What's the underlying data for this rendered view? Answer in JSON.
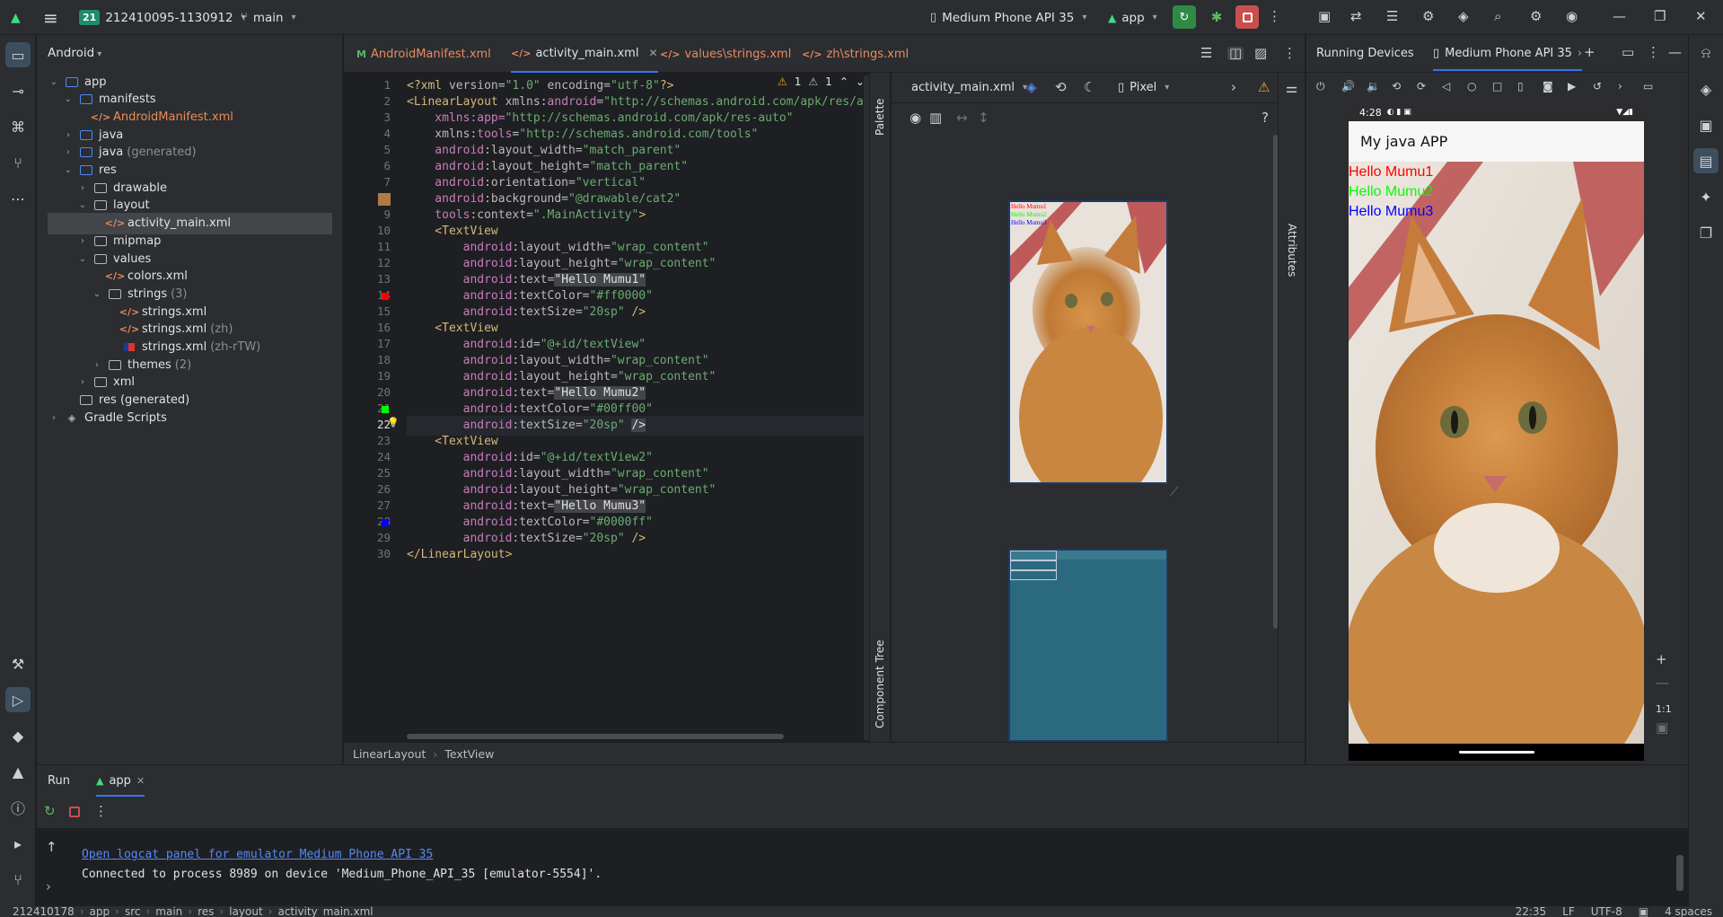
{
  "titlebar": {
    "project_badge": "21",
    "project_name": "212410095-1130912",
    "branch": "main",
    "device": "Medium Phone API 35",
    "run_config": "app"
  },
  "sidebar_left": {
    "items": [
      "folder-icon",
      "commit-icon",
      "structure-icon",
      "vcs-icon",
      "more-icon",
      "build-icon",
      "running-devices-icon",
      "gem-icon",
      "terminal-icon",
      "problems-icon",
      "console-icon",
      "git-icon"
    ]
  },
  "project": {
    "view": "Android",
    "tree": [
      {
        "label": "app",
        "indent": 0,
        "arrow": "open",
        "icon": "folder-blue",
        "sub": ""
      },
      {
        "label": "manifests",
        "indent": 1,
        "arrow": "open",
        "icon": "folder-blue",
        "sub": ""
      },
      {
        "label": "AndroidManifest.xml",
        "indent": 2,
        "arrow": "",
        "icon": "xml",
        "sub": "",
        "orange": true
      },
      {
        "label": "java",
        "indent": 1,
        "arrow": "closed",
        "icon": "folder-blue",
        "sub": ""
      },
      {
        "label": "java",
        "indent": 1,
        "arrow": "closed",
        "icon": "folder-blue",
        "sub": "(generated)"
      },
      {
        "label": "res",
        "indent": 1,
        "arrow": "open",
        "icon": "folder-blue",
        "sub": ""
      },
      {
        "label": "drawable",
        "indent": 2,
        "arrow": "closed",
        "icon": "folder",
        "sub": ""
      },
      {
        "label": "layout",
        "indent": 2,
        "arrow": "open",
        "icon": "folder",
        "sub": ""
      },
      {
        "label": "activity_main.xml",
        "indent": 3,
        "arrow": "",
        "icon": "xml",
        "sub": "",
        "selected": true
      },
      {
        "label": "mipmap",
        "indent": 2,
        "arrow": "closed",
        "icon": "folder",
        "sub": ""
      },
      {
        "label": "values",
        "indent": 2,
        "arrow": "open",
        "icon": "folder",
        "sub": ""
      },
      {
        "label": "colors.xml",
        "indent": 3,
        "arrow": "",
        "icon": "xml",
        "sub": ""
      },
      {
        "label": "strings",
        "indent": 3,
        "arrow": "open",
        "icon": "folder",
        "sub": "(3)"
      },
      {
        "label": "strings.xml",
        "indent": 4,
        "arrow": "",
        "icon": "xml",
        "sub": ""
      },
      {
        "label": "strings.xml",
        "indent": 4,
        "arrow": "",
        "icon": "xml",
        "sub": "(zh)"
      },
      {
        "label": "strings.xml",
        "indent": 4,
        "arrow": "",
        "icon": "flag",
        "sub": "(zh-rTW)"
      },
      {
        "label": "themes",
        "indent": 3,
        "arrow": "closed",
        "icon": "folder",
        "sub": "(2)"
      },
      {
        "label": "xml",
        "indent": 2,
        "arrow": "closed",
        "icon": "folder",
        "sub": ""
      },
      {
        "label": "res (generated)",
        "indent": 1,
        "arrow": "",
        "icon": "folder",
        "sub": ""
      },
      {
        "label": "Gradle Scripts",
        "indent": 0,
        "arrow": "closed",
        "icon": "gradle",
        "sub": ""
      }
    ]
  },
  "editor_tabs": [
    {
      "label": "AndroidManifest.xml",
      "active": false,
      "icon": "m"
    },
    {
      "label": "activity_main.xml",
      "active": true,
      "icon": "xml"
    },
    {
      "label": "values\\strings.xml",
      "active": false,
      "icon": "xml"
    },
    {
      "label": "zh\\strings.xml",
      "active": false,
      "icon": "xml"
    }
  ],
  "code_info": {
    "warnings": "1",
    "weak": "1"
  },
  "current_line": 22,
  "code_lines": [
    [
      [
        "tg",
        "<?xml "
      ],
      [
        "at",
        "version="
      ],
      [
        "st",
        "\"1.0\""
      ],
      [
        "at",
        " encoding="
      ],
      [
        "st",
        "\"utf-8\""
      ],
      [
        "tg",
        "?>"
      ]
    ],
    [
      [
        "tg",
        "<LinearLayout "
      ],
      [
        "at",
        "xmlns:"
      ],
      [
        "ns",
        "android"
      ],
      [
        "at",
        "="
      ],
      [
        "st",
        "\"http://schemas.android.com/apk/res/a"
      ]
    ],
    [
      [
        "ns",
        "    xmlns:app="
      ],
      [
        "st",
        "\"http://schemas.android.com/apk/res-auto\""
      ]
    ],
    [
      [
        "at",
        "    xmlns:"
      ],
      [
        "ns",
        "tools"
      ],
      [
        "at",
        "="
      ],
      [
        "st",
        "\"http://schemas.android.com/tools\""
      ]
    ],
    [
      [
        "ns",
        "    android"
      ],
      [
        "at",
        ":layout_width="
      ],
      [
        "st",
        "\"match_parent\""
      ]
    ],
    [
      [
        "ns",
        "    android"
      ],
      [
        "at",
        ":layout_height="
      ],
      [
        "st",
        "\"match_parent\""
      ]
    ],
    [
      [
        "ns",
        "    android"
      ],
      [
        "at",
        ":orientation="
      ],
      [
        "st",
        "\"vertical\""
      ]
    ],
    [
      [
        "ns",
        "    android"
      ],
      [
        "at",
        ":background="
      ],
      [
        "st",
        "\"@drawable/cat2\""
      ]
    ],
    [
      [
        "ns",
        "    tools"
      ],
      [
        "at",
        ":context="
      ],
      [
        "st",
        "\".MainActivity\""
      ],
      [
        "tg",
        ">"
      ]
    ],
    [
      [
        "tg",
        "    <TextView"
      ]
    ],
    [
      [
        "ns",
        "        android"
      ],
      [
        "at",
        ":layout_width="
      ],
      [
        "st",
        "\"wrap_content\""
      ]
    ],
    [
      [
        "ns",
        "        android"
      ],
      [
        "at",
        ":layout_height="
      ],
      [
        "st",
        "\"wrap_content\""
      ]
    ],
    [
      [
        "ns",
        "        android"
      ],
      [
        "at",
        ":text="
      ],
      [
        "hl",
        "\"Hello Mumu1\""
      ]
    ],
    [
      [
        "ns",
        "        android"
      ],
      [
        "at",
        ":textColor="
      ],
      [
        "st",
        "\"#ff0000\""
      ]
    ],
    [
      [
        "ns",
        "        android"
      ],
      [
        "at",
        ":textSize="
      ],
      [
        "st",
        "\"20sp\""
      ],
      [
        "tg",
        " />"
      ]
    ],
    [
      [
        "tg",
        "    <TextView"
      ]
    ],
    [
      [
        "ns",
        "        android"
      ],
      [
        "at",
        ":id="
      ],
      [
        "st",
        "\"@+id/textView\""
      ]
    ],
    [
      [
        "ns",
        "        android"
      ],
      [
        "at",
        ":layout_width="
      ],
      [
        "st",
        "\"wrap_content\""
      ]
    ],
    [
      [
        "ns",
        "        android"
      ],
      [
        "at",
        ":layout_height="
      ],
      [
        "st",
        "\"wrap_content\""
      ]
    ],
    [
      [
        "ns",
        "        android"
      ],
      [
        "at",
        ":text="
      ],
      [
        "hl",
        "\"Hello Mumu2\""
      ]
    ],
    [
      [
        "ns",
        "        android"
      ],
      [
        "at",
        ":textColor="
      ],
      [
        "st",
        "\"#00ff00\""
      ]
    ],
    [
      [
        "ns",
        "        android"
      ],
      [
        "at",
        ":textSize="
      ],
      [
        "st",
        "\"20sp\" "
      ],
      [
        "hl",
        "/>"
      ]
    ],
    [
      [
        "tg",
        "    <TextView"
      ]
    ],
    [
      [
        "ns",
        "        android"
      ],
      [
        "at",
        ":id="
      ],
      [
        "st",
        "\"@+id/textView2\""
      ]
    ],
    [
      [
        "ns",
        "        android"
      ],
      [
        "at",
        ":layout_width="
      ],
      [
        "st",
        "\"wrap_content\""
      ]
    ],
    [
      [
        "ns",
        "        android"
      ],
      [
        "at",
        ":layout_height="
      ],
      [
        "st",
        "\"wrap_content\""
      ]
    ],
    [
      [
        "ns",
        "        android"
      ],
      [
        "at",
        ":text="
      ],
      [
        "hl",
        "\"Hello Mumu3\""
      ]
    ],
    [
      [
        "ns",
        "        android"
      ],
      [
        "at",
        ":textColor="
      ],
      [
        "st",
        "\"#0000ff\""
      ]
    ],
    [
      [
        "ns",
        "        android"
      ],
      [
        "at",
        ":textSize="
      ],
      [
        "st",
        "\"20sp\""
      ],
      [
        "tg",
        " />"
      ]
    ],
    [
      [
        "tg",
        "</LinearLayout>"
      ]
    ]
  ],
  "gutter_marks": {
    "8": "image",
    "14": "#ff0000",
    "21": "#00ff00",
    "28": "#0000ff",
    "22": "bulb"
  },
  "design": {
    "file": "activity_main.xml",
    "device": "Pixel",
    "palette": "Palette",
    "component_tree": "Component Tree",
    "attributes": "Attributes"
  },
  "breadcrumb": [
    "LinearLayout",
    "TextView"
  ],
  "running": {
    "title": "Running Devices",
    "device_tab": "Medium Phone API 35",
    "status_time": "4:28",
    "app_title": "My java APP",
    "texts": [
      {
        "text": "Hello Mumu1",
        "color": "#ff0000"
      },
      {
        "text": "Hello Mumu2",
        "color": "#00ff00"
      },
      {
        "text": "Hello Mumu3",
        "color": "#0000ff"
      }
    ],
    "zoom_label": "1:1"
  },
  "run_panel": {
    "tab": "Run",
    "config": "app",
    "link": "Open logcat panel for emulator Medium Phone API 35",
    "message": "Connected to process 8989 on device 'Medium_Phone_API_35 [emulator-5554]'."
  },
  "statusline": {
    "crumbs": [
      "212410178",
      "app",
      "src",
      "main",
      "res",
      "layout",
      "activity_main.xml"
    ],
    "pos": "22:35",
    "lf": "LF",
    "enc": "UTF-8",
    "indent": "4 spaces"
  }
}
